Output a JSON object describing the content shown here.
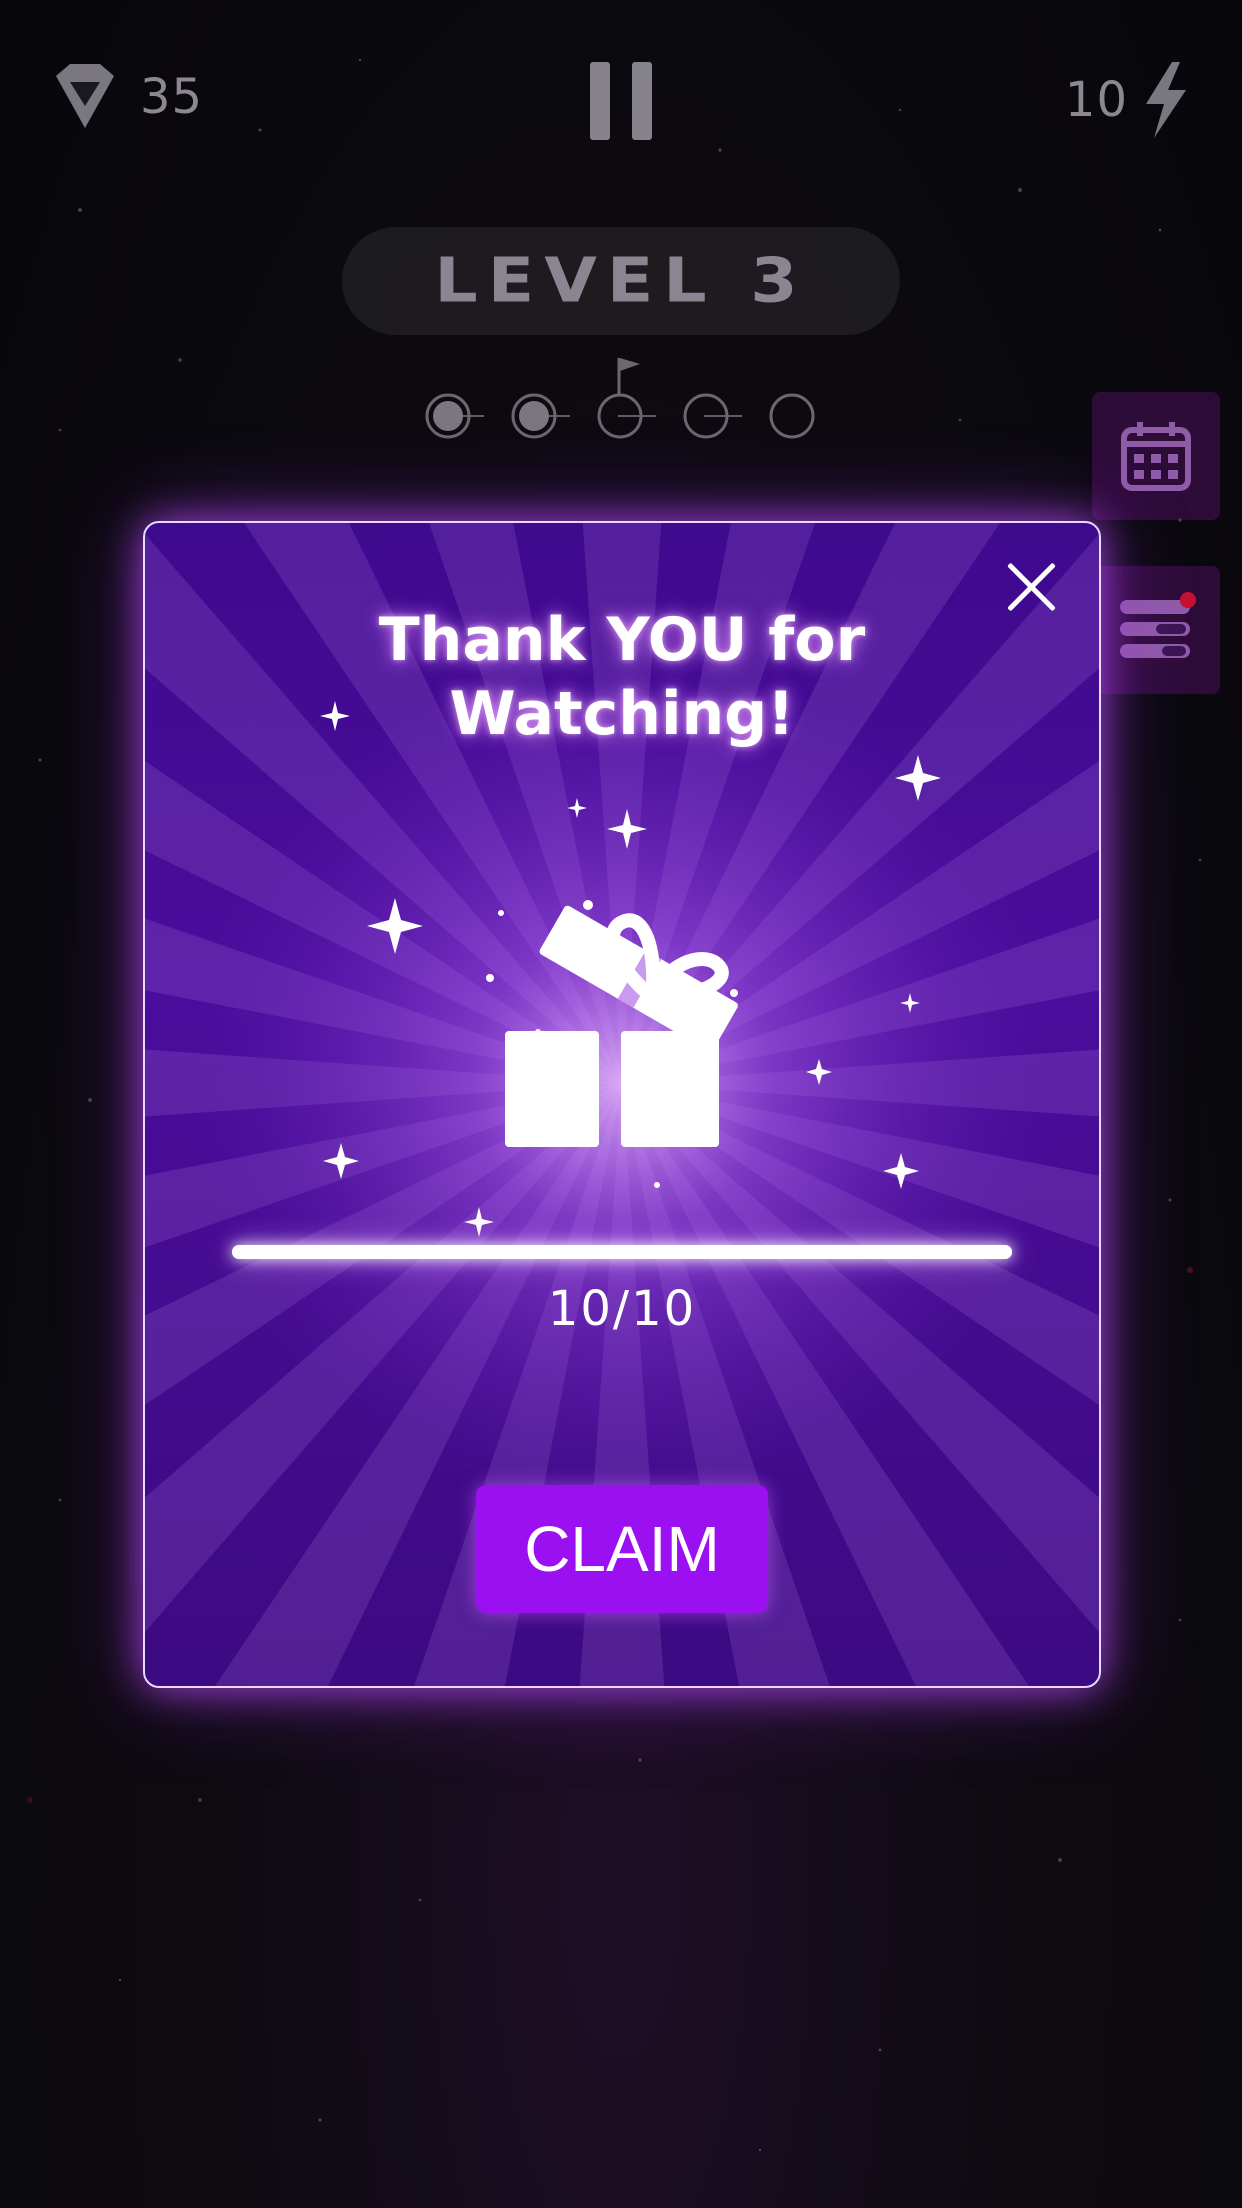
{
  "hud": {
    "gems": "35",
    "energy": "10",
    "gem_icon": "diamond-icon",
    "energy_icon": "lightning-icon",
    "pause_icon": "pause-icon"
  },
  "level": {
    "label": "LEVEL 3",
    "stages_total": 5,
    "stages_completed": 2,
    "flag_stage": 3
  },
  "side_buttons": [
    {
      "icon": "calendar-icon"
    },
    {
      "icon": "tasks-list-icon",
      "has_notification": true
    }
  ],
  "modal": {
    "title_line1": "Thank YOU for",
    "title_line2": "Watching!",
    "icon": "gift-icon",
    "progress_current": 10,
    "progress_max": 10,
    "progress_text": "10/10",
    "claim_label": "CLAIM"
  },
  "colors": {
    "modal_bg": "#420c92",
    "claim_button": "#9a10f0",
    "glow": "#c060ff",
    "hud_gray": "#8a8590"
  }
}
